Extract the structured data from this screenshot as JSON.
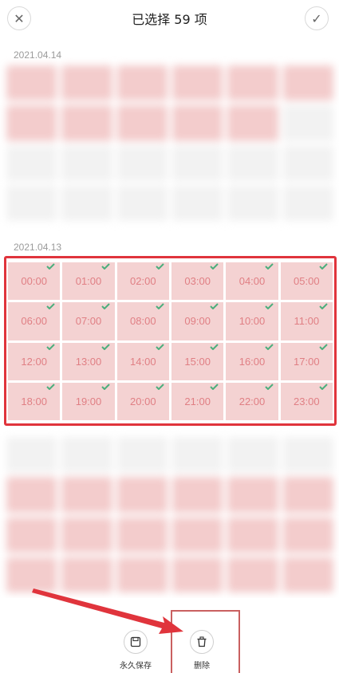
{
  "header": {
    "title": "已选择 59 项",
    "close_glyph": "✕",
    "confirm_glyph": "✓"
  },
  "sections": [
    {
      "date": "2021.04.14"
    },
    {
      "date": "2021.04.13",
      "items": [
        "00:00",
        "01:00",
        "02:00",
        "03:00",
        "04:00",
        "05:00",
        "06:00",
        "07:00",
        "08:00",
        "09:00",
        "10:00",
        "11:00",
        "12:00",
        "13:00",
        "14:00",
        "15:00",
        "16:00",
        "17:00",
        "18:00",
        "19:00",
        "20:00",
        "21:00",
        "22:00",
        "23:00"
      ]
    }
  ],
  "actions": {
    "save_label": "永久保存",
    "delete_label": "删除"
  },
  "colors": {
    "highlight": "#e0343c",
    "check": "#4cae7c",
    "time_text": "#e07f84"
  }
}
